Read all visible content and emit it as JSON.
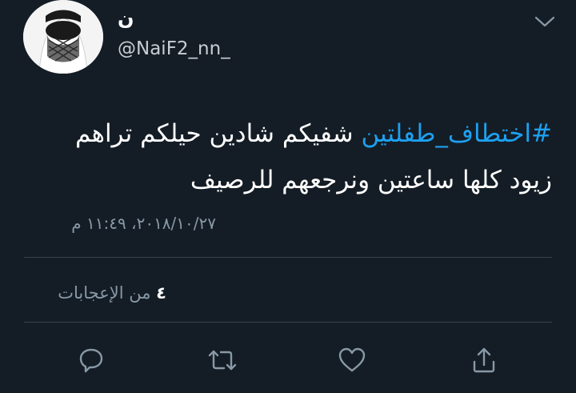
{
  "author": {
    "display_name": "ن",
    "handle": "@NaiF2_nn_"
  },
  "tweet": {
    "hashtag": "#اختطاف_طفلتين",
    "text_line1": " شفيكم شادين حيلكم تراهم",
    "text_line2": "زيود كلها ساعتين ونرجعهم للرصيف"
  },
  "timestamp": "٢٠١٨/١٠/٢٧، ١١:٤٩ م",
  "likes": {
    "count": "٤",
    "label": " من الإعجابات"
  },
  "icons": {
    "menu": "chevron-down-icon",
    "reply": "reply-icon",
    "retweet": "retweet-icon",
    "like": "heart-icon",
    "share": "share-icon"
  },
  "colors": {
    "background": "#141d26",
    "hashtag": "#1da1f2",
    "secondary_text": "#8899a6",
    "divider": "#38444d"
  }
}
